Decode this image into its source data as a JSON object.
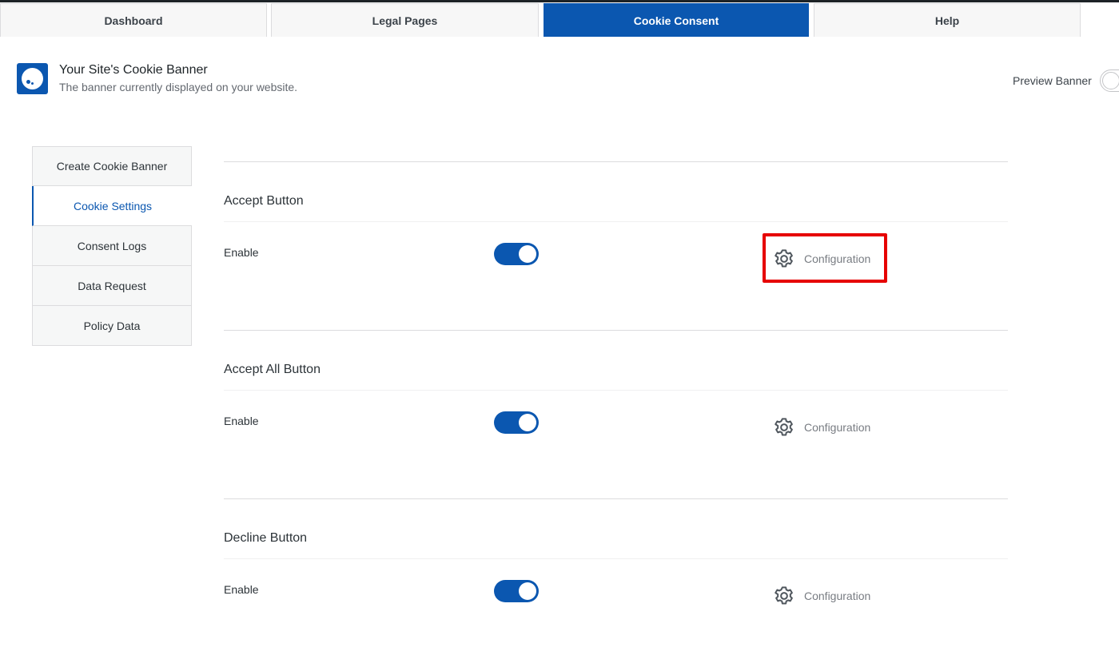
{
  "tabs": [
    {
      "label": "Dashboard",
      "active": false
    },
    {
      "label": "Legal Pages",
      "active": false
    },
    {
      "label": "Cookie Consent",
      "active": true
    },
    {
      "label": "Help",
      "active": false
    }
  ],
  "header": {
    "title": "Your Site's Cookie Banner",
    "subtitle": "The banner currently displayed on your website.",
    "preview_label": "Preview Banner"
  },
  "sidenav": {
    "items": [
      {
        "label": "Create Cookie Banner",
        "active": false
      },
      {
        "label": "Cookie Settings",
        "active": true
      },
      {
        "label": "Consent Logs",
        "active": false
      },
      {
        "label": "Data Request",
        "active": false
      },
      {
        "label": "Policy Data",
        "active": false
      }
    ]
  },
  "sections": [
    {
      "title": "Accept Button",
      "enable_label": "Enable",
      "enabled": true,
      "config_label": "Configuration",
      "highlighted": true
    },
    {
      "title": "Accept All Button",
      "enable_label": "Enable",
      "enabled": true,
      "config_label": "Configuration",
      "highlighted": false
    },
    {
      "title": "Decline Button",
      "enable_label": "Enable",
      "enabled": true,
      "config_label": "Configuration",
      "highlighted": false
    }
  ],
  "colors": {
    "accent": "#0b57b0",
    "highlight": "#e60000"
  },
  "icons": {
    "config": "gear-icon",
    "logo": "cookie-logo-icon"
  }
}
